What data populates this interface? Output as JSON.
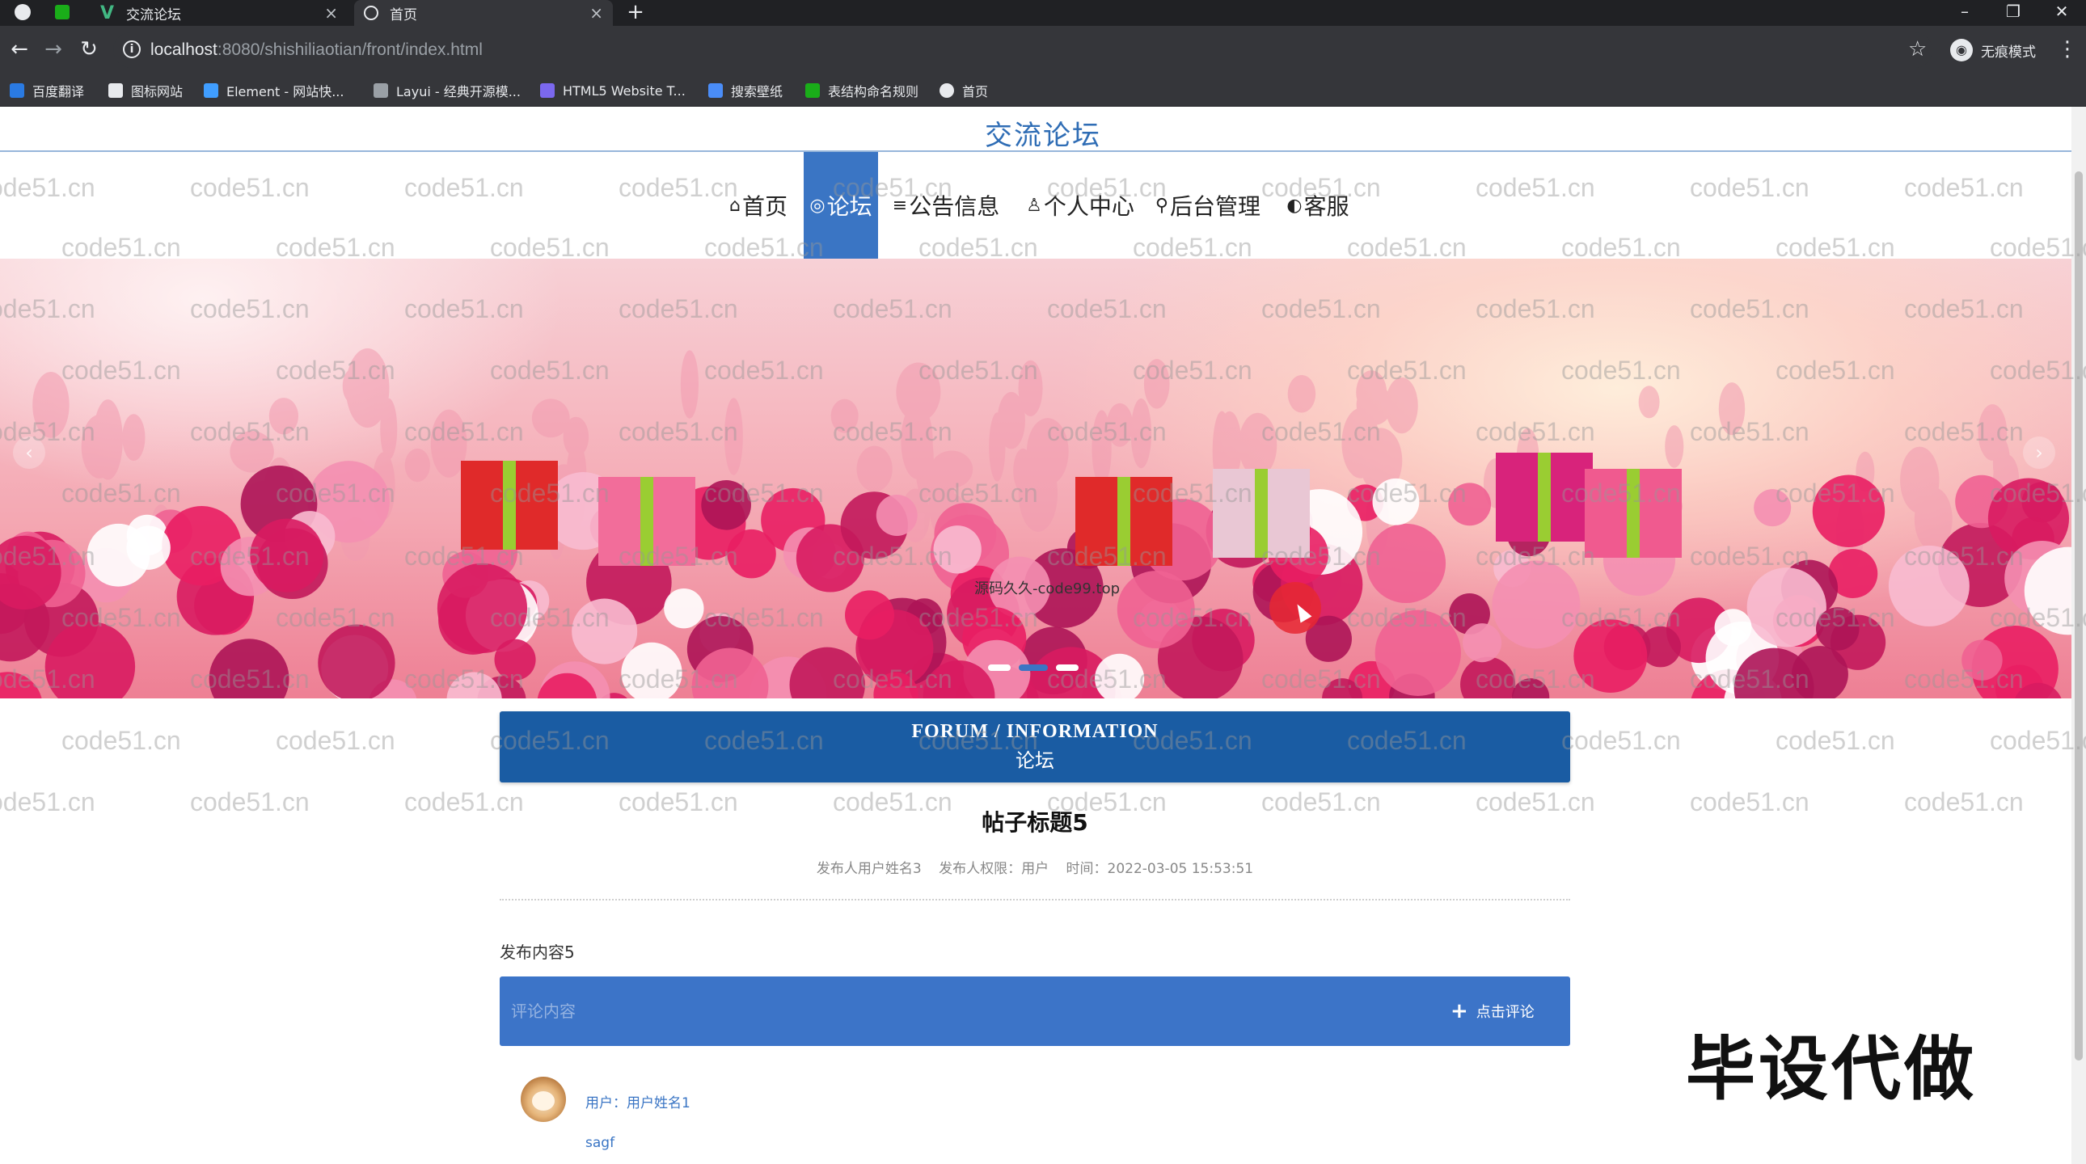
{
  "browser": {
    "tabs": [
      {
        "label": "交流论坛"
      },
      {
        "label": "首页"
      }
    ],
    "url_host": "localhost",
    "url_rest": ":8080/shishiliaotian/front/index.html",
    "incognito_label": "无痕模式",
    "bookmarks": [
      {
        "label": "百度翻译",
        "color": "#2a7ae2"
      },
      {
        "label": "图标网站",
        "color": "#e8eaed"
      },
      {
        "label": "Element - 网站快...",
        "color": "#409eff"
      },
      {
        "label": "Layui - 经典开源模...",
        "color": "#9aa0a6"
      },
      {
        "label": "HTML5 Website T...",
        "color": "#7b68ee"
      },
      {
        "label": "搜索壁纸",
        "color": "#4a8df8"
      },
      {
        "label": "表结构命名规则",
        "color": "#1aad19"
      },
      {
        "label": "首页",
        "color": "#e8eaed"
      }
    ]
  },
  "site": {
    "title": "交流论坛",
    "nav": [
      {
        "icon": "⌂",
        "label": "首页"
      },
      {
        "icon": "◎",
        "label": "论坛",
        "active": true
      },
      {
        "icon": "≡",
        "label": "公告信息"
      },
      {
        "icon": "♙",
        "label": "个人中心"
      },
      {
        "icon": "⚲",
        "label": "后台管理"
      },
      {
        "icon": "◐",
        "label": "客服"
      }
    ],
    "banner_caption": "源码久久-code99.top"
  },
  "section": {
    "title_en": "FORUM / INFORMATION",
    "title_cn": "论坛"
  },
  "post": {
    "title": "帖子标题5",
    "author": "发布人用户姓名3",
    "permission": "发布人权限：用户",
    "time": "时间：2022-03-05 15:53:51",
    "content": "发布内容5"
  },
  "comment_form": {
    "placeholder": "评论内容",
    "button_label": "点击评论"
  },
  "comments": [
    {
      "user": "用户：用户姓名1",
      "text": "sagf"
    }
  ],
  "watermark_text": "code51.cn",
  "overlay_text": "毕设代做",
  "colors": {
    "accent": "#3a75c4",
    "header_blue": "#1a5ca3",
    "title_blue": "#2f6db5"
  }
}
